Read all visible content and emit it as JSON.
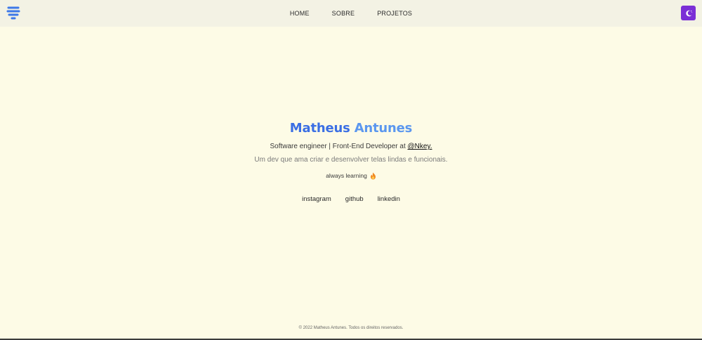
{
  "navbar": {
    "logo_icon": "layers-logo-icon",
    "links": [
      {
        "label": "HOME"
      },
      {
        "label": "SOBRE"
      },
      {
        "label": "PROJETOS"
      }
    ],
    "theme_toggle_icon": "moon-icon",
    "theme_toggle_color": "#7b2fd6"
  },
  "hero": {
    "first_name": "Matheus",
    "last_name": "Antunes",
    "role_text": "Software engineer | Front-End Developer at",
    "company_link": "@Nkey.",
    "description": "Um dev que ama criar e desenvolver telas lindas e funcionais.",
    "learning_text": "always learning",
    "learning_icon": "fire-icon"
  },
  "socials": [
    {
      "label": "instagram"
    },
    {
      "label": "github"
    },
    {
      "label": "linkedin"
    }
  ],
  "footer": {
    "text": "© 2022 Matheus Antunes. Todos os direitos reservados."
  },
  "colors": {
    "background": "#fdfbe6",
    "navbar": "#f3f2e4",
    "accent_blue": "#3b6fe4",
    "accent_light_blue": "#5b97ef",
    "accent_purple": "#7b2fd6"
  }
}
